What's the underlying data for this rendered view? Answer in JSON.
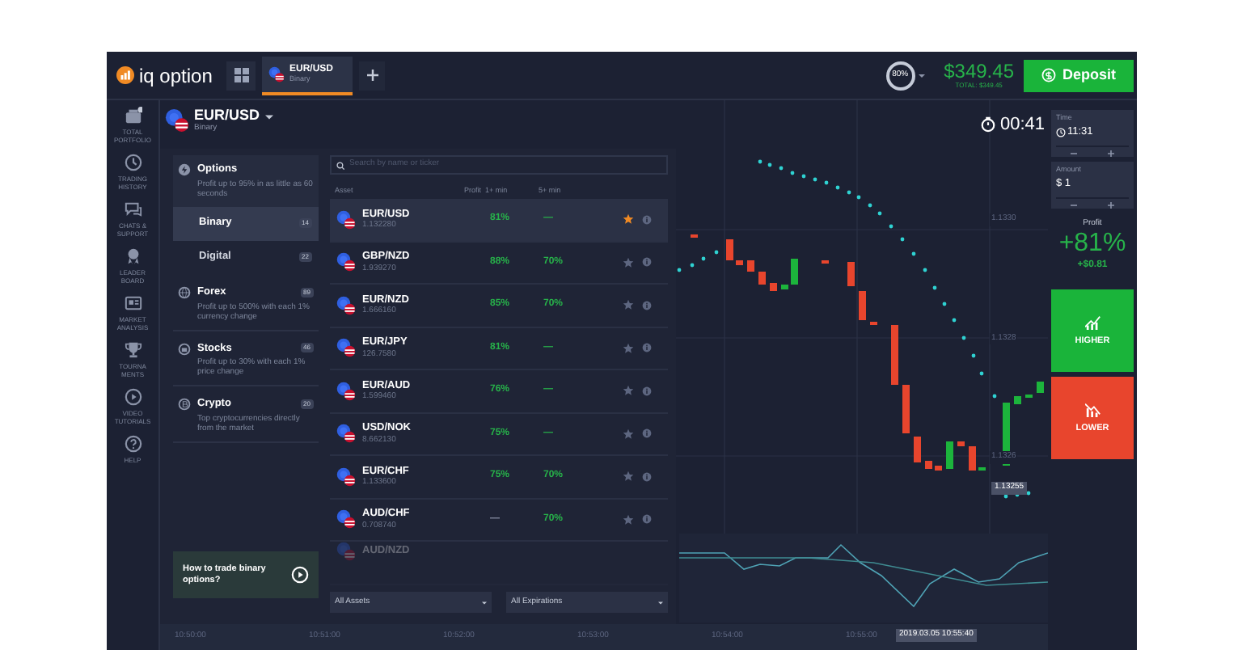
{
  "topbar": {
    "logo": "iq option",
    "tabs": [
      {
        "title": "EUR/USD",
        "subtitle": "Binary",
        "selected": true
      }
    ],
    "level_badge": "80%",
    "balance": "$349.45",
    "balance_total": "TOTAL: $349.45",
    "deposit": "Deposit"
  },
  "sidebar": {
    "items": [
      {
        "kind": "portfolio",
        "label": "TOTAL PORTFOLIO"
      },
      {
        "kind": "history",
        "label": "TRADING HISTORY"
      },
      {
        "kind": "chat",
        "label": "CHATS & SUPPORT"
      },
      {
        "kind": "leaderboard",
        "label": "LEADER BOARD"
      },
      {
        "kind": "analysis",
        "label": "MARKET ANALYSIS"
      },
      {
        "kind": "tournaments",
        "label": "TOURNA MENTS"
      },
      {
        "kind": "video",
        "label": "VIDEO TUTORIALS"
      },
      {
        "kind": "help",
        "label": "HELP"
      }
    ]
  },
  "chart_header": {
    "asset": "EUR/USD",
    "type": "Binary",
    "timer": "00:41"
  },
  "categories": [
    {
      "title": "Options",
      "description": "Profit up to 95% in as little as 60 seconds",
      "children": [
        {
          "label": "Binary",
          "count": "14",
          "selected": true
        },
        {
          "label": "Digital",
          "count": "22",
          "selected": false
        }
      ]
    },
    {
      "title": "Forex",
      "count": "89",
      "description": "Profit up to 500% with each 1% currency change"
    },
    {
      "title": "Stocks",
      "count": "46",
      "description": "Profit up to 30% with each 1% price change"
    },
    {
      "title": "Crypto",
      "count": "20",
      "description": "Top cryptocurrencies directly from the market"
    }
  ],
  "promo": {
    "title": "How to trade binary options?"
  },
  "assets": {
    "search_placeholder": "Search by name or ticker",
    "columns": [
      "Asset",
      "Profit",
      "1+ min",
      "5+ min"
    ],
    "rows": [
      {
        "name": "EUR/USD",
        "price": "1.132280",
        "profit_1": "81%",
        "profit_5": "—",
        "favorite": true,
        "selected": true
      },
      {
        "name": "GBP/NZD",
        "price": "1.939270",
        "profit_1": "88%",
        "profit_5": "70%",
        "favorite": false,
        "selected": false
      },
      {
        "name": "EUR/NZD",
        "price": "1.666160",
        "profit_1": "85%",
        "profit_5": "70%",
        "favorite": false,
        "selected": false
      },
      {
        "name": "EUR/JPY",
        "price": "126.7580",
        "profit_1": "81%",
        "profit_5": "—",
        "favorite": false,
        "selected": false
      },
      {
        "name": "EUR/AUD",
        "price": "1.599460",
        "profit_1": "76%",
        "profit_5": "—",
        "favorite": false,
        "selected": false
      },
      {
        "name": "USD/NOK",
        "price": "8.662130",
        "profit_1": "75%",
        "profit_5": "—",
        "favorite": false,
        "selected": false
      },
      {
        "name": "EUR/CHF",
        "price": "1.133600",
        "profit_1": "75%",
        "profit_5": "70%",
        "favorite": false,
        "selected": false
      },
      {
        "name": "AUD/CHF",
        "price": "0.708740",
        "profit_1": "—",
        "profit_5": "70%",
        "favorite": false,
        "selected": false
      },
      {
        "name": "AUD/NZD",
        "faded": true
      }
    ],
    "filters": [
      "All Assets",
      "All Expirations"
    ]
  },
  "chart": {
    "price_labels": [
      "1.1330",
      "1.1328",
      "1.1326"
    ],
    "current_price": "1.13255",
    "time_labels": [
      "10:50:00",
      "10:51:00",
      "10:52:00",
      "10:53:00",
      "10:54:00",
      "10:55:00"
    ],
    "crosshair_time": "2019.03.05 10:55:40"
  },
  "trade_panel": {
    "time_label": "Time",
    "time": "11:31",
    "amount_label": "Amount",
    "amount": "$ 1",
    "profit_label": "Profit",
    "profit": "+81%",
    "profit_amount": "+$0.81",
    "higher": "HIGHER",
    "lower": "LOWER"
  }
}
